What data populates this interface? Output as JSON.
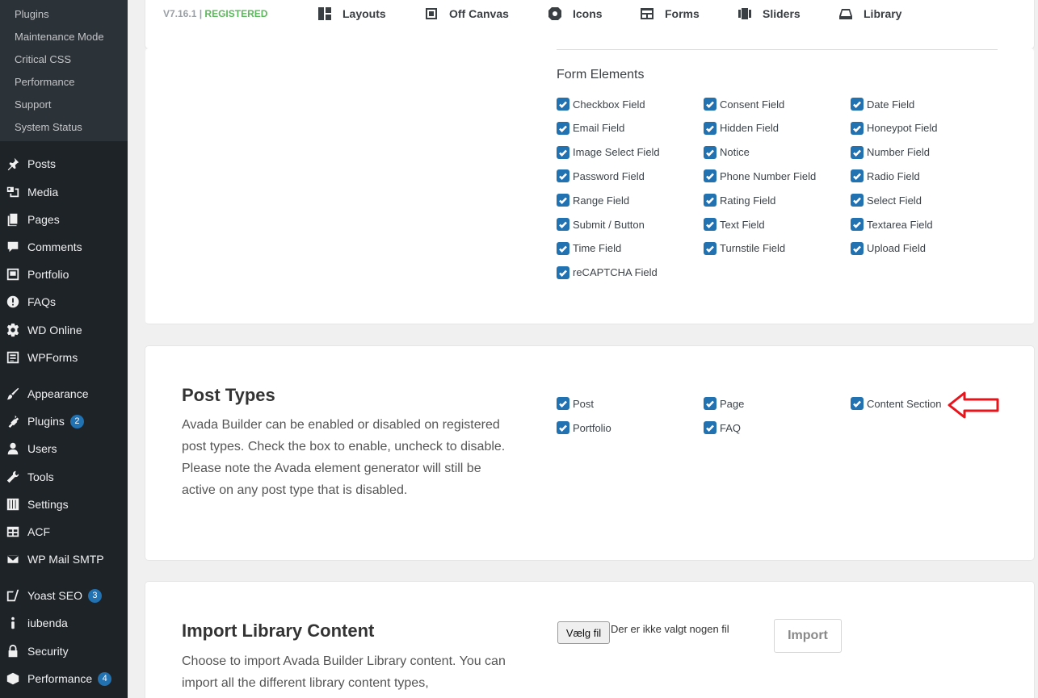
{
  "sidebar": {
    "submenu": [
      "Plugins",
      "Maintenance Mode",
      "Critical CSS",
      "Performance",
      "Support",
      "System Status"
    ],
    "items": [
      {
        "label": "Posts",
        "icon": "pin-icon",
        "badge": ""
      },
      {
        "label": "Media",
        "icon": "media-icon",
        "badge": ""
      },
      {
        "label": "Pages",
        "icon": "pages-icon",
        "badge": ""
      },
      {
        "label": "Comments",
        "icon": "comments-icon",
        "badge": ""
      },
      {
        "label": "Portfolio",
        "icon": "portfolio-icon",
        "badge": ""
      },
      {
        "label": "FAQs",
        "icon": "info-icon",
        "badge": ""
      },
      {
        "label": "WD Online",
        "icon": "gear-icon",
        "badge": ""
      },
      {
        "label": "WPForms",
        "icon": "form-icon",
        "badge": ""
      },
      {
        "label": "Appearance",
        "icon": "brush-icon",
        "badge": ""
      },
      {
        "label": "Plugins",
        "icon": "plug-icon",
        "badge": "2"
      },
      {
        "label": "Users",
        "icon": "user-icon",
        "badge": ""
      },
      {
        "label": "Tools",
        "icon": "wrench-icon",
        "badge": ""
      },
      {
        "label": "Settings",
        "icon": "sliders-icon",
        "badge": ""
      },
      {
        "label": "ACF",
        "icon": "table-icon",
        "badge": ""
      },
      {
        "label": "WP Mail SMTP",
        "icon": "mail-icon",
        "badge": ""
      },
      {
        "label": "Yoast SEO",
        "icon": "yoast-icon",
        "badge": "3"
      },
      {
        "label": "iubenda",
        "icon": "iubenda-icon",
        "badge": ""
      },
      {
        "label": "Security",
        "icon": "lock-icon",
        "badge": ""
      },
      {
        "label": "Performance",
        "icon": "cube-icon",
        "badge": "4"
      }
    ]
  },
  "topnav": {
    "version": "V7.16.1",
    "separator": "|",
    "registered": "REGISTERED",
    "items": [
      {
        "label": "Layouts",
        "icon": "layouts-icon"
      },
      {
        "label": "Off Canvas",
        "icon": "off-canvas-icon"
      },
      {
        "label": "Icons",
        "icon": "icons-icon"
      },
      {
        "label": "Forms",
        "icon": "forms-icon"
      },
      {
        "label": "Sliders",
        "icon": "sliders-icon"
      },
      {
        "label": "Library",
        "icon": "library-icon"
      }
    ]
  },
  "form_elements": {
    "title": "Form Elements",
    "items": [
      "Checkbox Field",
      "Consent Field",
      "Date Field",
      "Email Field",
      "Hidden Field",
      "Honeypot Field",
      "Image Select Field",
      "Notice",
      "Number Field",
      "Password Field",
      "Phone Number Field",
      "Radio Field",
      "Range Field",
      "Rating Field",
      "Select Field",
      "Submit / Button",
      "Text Field",
      "Textarea Field",
      "Time Field",
      "Turnstile Field",
      "Upload Field",
      "reCAPTCHA Field"
    ]
  },
  "post_types": {
    "title": "Post Types",
    "description": "Avada Builder can be enabled or disabled on registered post types. Check the box to enable, uncheck to disable. Please note the Avada element generator will still be active on any post type that is disabled.",
    "items": [
      "Post",
      "Page",
      "Content Section",
      "Portfolio",
      "FAQ"
    ]
  },
  "import_library": {
    "title": "Import Library Content",
    "description": "Choose to import Avada Builder Library content. You can import all the different library content types,",
    "file_button": "Vælg fil",
    "file_status": "Der er ikke valgt nogen fil",
    "import_button": "Import"
  },
  "colors": {
    "sidebar_bg": "#1d2327",
    "accent": "#2271b1",
    "registered": "#5cb85c",
    "annotation_arrow": "#e8141b"
  }
}
